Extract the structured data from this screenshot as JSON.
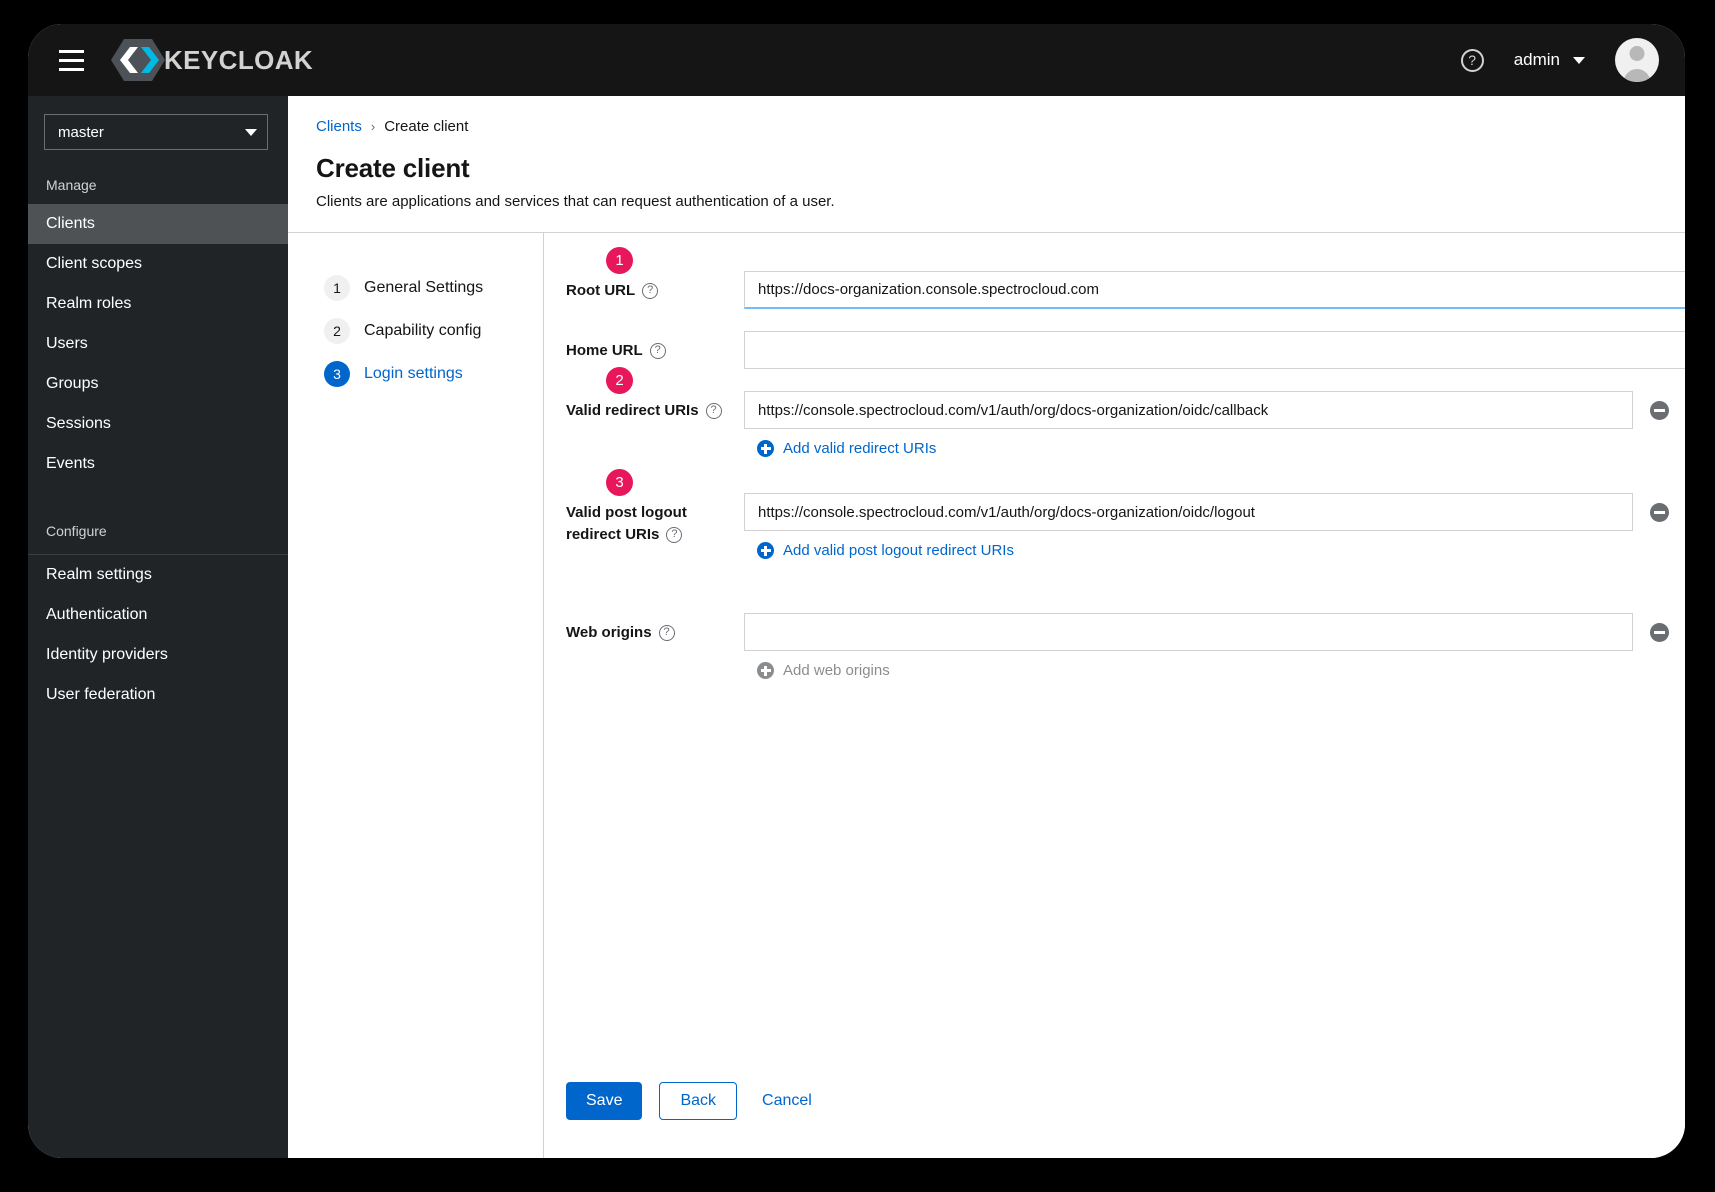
{
  "masthead": {
    "menu_icon": "hamburger-icon",
    "brand_name": "KEYCLOAK",
    "help_icon": "question-circle-icon",
    "user_name": "admin",
    "avatar_icon": "user-avatar-icon"
  },
  "sidebar": {
    "realm_selector": {
      "value": "master",
      "caret_icon": "caret-down-icon"
    },
    "sections": [
      {
        "title": "Manage",
        "items": [
          {
            "label": "Clients",
            "active": true
          },
          {
            "label": "Client scopes",
            "active": false
          },
          {
            "label": "Realm roles",
            "active": false
          },
          {
            "label": "Users",
            "active": false
          },
          {
            "label": "Groups",
            "active": false
          },
          {
            "label": "Sessions",
            "active": false
          },
          {
            "label": "Events",
            "active": false
          }
        ]
      },
      {
        "title": "Configure",
        "items": [
          {
            "label": "Realm settings",
            "active": false
          },
          {
            "label": "Authentication",
            "active": false
          },
          {
            "label": "Identity providers",
            "active": false
          },
          {
            "label": "User federation",
            "active": false
          }
        ]
      }
    ]
  },
  "page": {
    "breadcrumb": {
      "parent": "Clients",
      "separator": "›",
      "current": "Create client"
    },
    "title": "Create client",
    "subtitle": "Clients are applications and services that can request authentication of a user."
  },
  "wizard": {
    "steps": [
      {
        "number": "1",
        "label": "General Settings",
        "active": false
      },
      {
        "number": "2",
        "label": "Capability config",
        "active": false
      },
      {
        "number": "3",
        "label": "Login settings",
        "active": true
      }
    ],
    "accent_active": "#0066cc",
    "badge_color": "#e8165a",
    "fields": {
      "root_url": {
        "label": "Root URL",
        "help_icon": "help-circle-icon",
        "value": "https://docs-organization.console.spectrocloud.com",
        "placeholder": "",
        "badge": "1"
      },
      "home_url": {
        "label": "Home URL",
        "help_icon": "help-circle-icon",
        "value": "",
        "placeholder": ""
      },
      "valid_redirect_uris": {
        "label": "Valid redirect URIs",
        "help_icon": "help-circle-icon",
        "value": "https://console.spectrocloud.com/v1/auth/org/docs-organization/oidc/callback",
        "placeholder": "",
        "badge": "2",
        "add_label": "Add valid redirect URIs",
        "remove_icon": "minus-circle-icon",
        "add_icon": "plus-circle-icon"
      },
      "valid_post_logout_redirect_uris": {
        "label_line1": "Valid post logout",
        "label_line2": "redirect URIs",
        "help_icon": "help-circle-icon",
        "value": "https://console.spectrocloud.com/v1/auth/org/docs-organization/oidc/logout",
        "placeholder": "",
        "badge": "3",
        "add_label": "Add valid post logout redirect URIs",
        "remove_icon": "minus-circle-icon",
        "add_icon": "plus-circle-icon"
      },
      "web_origins": {
        "label": "Web origins",
        "help_icon": "help-circle-icon",
        "value": "",
        "placeholder": "",
        "add_label": "Add web origins",
        "remove_icon": "minus-circle-icon",
        "add_icon": "plus-circle-icon"
      }
    },
    "actions": {
      "save_label": "Save",
      "back_label": "Back",
      "cancel_label": "Cancel"
    }
  }
}
